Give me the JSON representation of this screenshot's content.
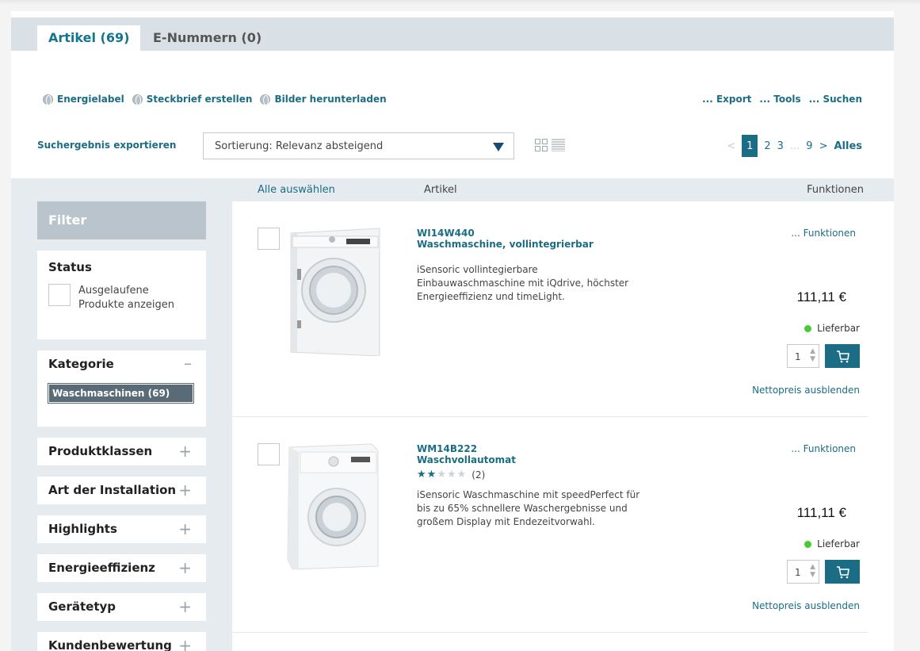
{
  "tabs": [
    {
      "label": "Artikel (69)"
    },
    {
      "label": "E-Nummern (0)"
    }
  ],
  "actions": {
    "energielabel": "Energielabel",
    "steckbrief": "Steckbrief erstellen",
    "bilder": "Bilder herunterladen",
    "export": "... Export",
    "tools": "... Tools",
    "suchen": "... Suchen"
  },
  "toolbar": {
    "export_link": "Suchergebnis exportieren",
    "sort_value": "Sortierung: Relevanz absteigend"
  },
  "pagination": {
    "prev": "<",
    "current": "1",
    "pages": [
      "2",
      "3"
    ],
    "dots": "...",
    "last": "9",
    "next": ">",
    "all": "Alles"
  },
  "list_header": {
    "select_all": "Alle auswählen",
    "article": "Artikel",
    "functions": "Funktionen"
  },
  "sidebar": {
    "filter_title": "Filter",
    "status": {
      "title": "Status",
      "checkbox_label": "Ausgelaufene Produkte anzeigen"
    },
    "kategorie": {
      "title": "Kategorie",
      "toggle": "–",
      "selected": "Waschmaschinen (69)"
    },
    "collapsed": [
      {
        "title": "Produktklassen",
        "toggle": "+"
      },
      {
        "title": "Art der Installation",
        "toggle": "+"
      },
      {
        "title": "Highlights",
        "toggle": "+"
      },
      {
        "title": "Energieeffizienz",
        "toggle": "+"
      },
      {
        "title": "Gerätetyp",
        "toggle": "+"
      },
      {
        "title": "Kundenbewertung",
        "toggle": "+"
      }
    ]
  },
  "products": [
    {
      "code": "WI14W440",
      "name": "Waschmaschine, vollintegrierbar",
      "description": "iSensoric vollintegierbare Einbauwaschmaschine mit iQdrive, höchster Energieeffizienz und timeLight.",
      "functions_link": "... Funktionen",
      "price": "111,11 €",
      "availability": "Lieferbar",
      "quantity": "1",
      "net_link": "Nettopreis ausblenden"
    },
    {
      "code": "WM14B222",
      "name": "Waschvollautomat",
      "rating": 2,
      "rating_max": 5,
      "review_count": "(2)",
      "description": "iSensoric Waschmaschine mit speedPerfect für bis zu 65% schnellere Waschergebnisse und großem Display mit Endezeitvorwahl.",
      "functions_link": "... Funktionen",
      "price": "111,11 €",
      "availability": "Lieferbar",
      "quantity": "1",
      "net_link": "Nettopreis ausblenden"
    }
  ],
  "colors": {
    "accent": "#1b6d86",
    "available": "#44cc33"
  }
}
